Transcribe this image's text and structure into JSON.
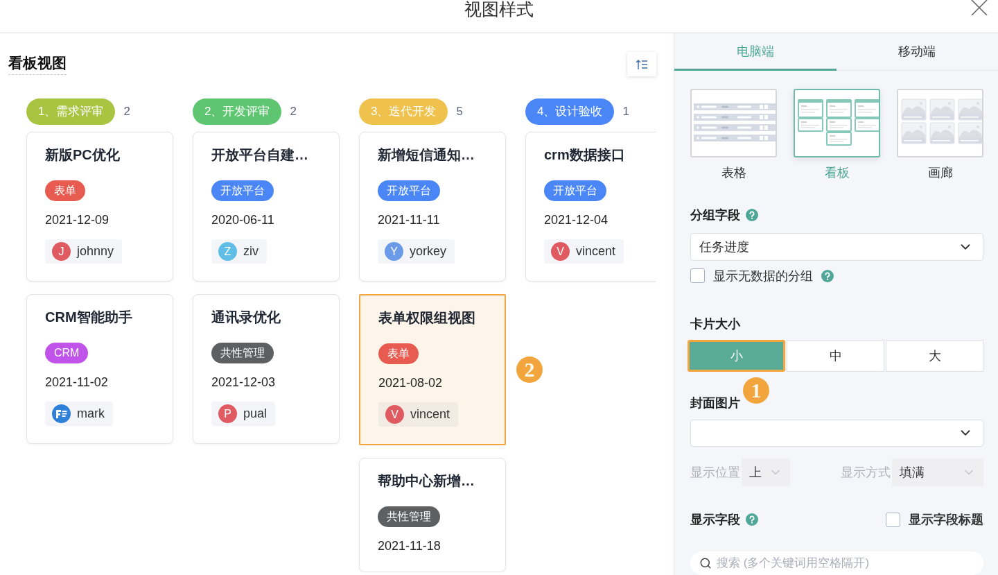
{
  "dialog": {
    "title": "视图样式"
  },
  "board": {
    "title": "看板视图",
    "columns": [
      {
        "label": "1、需求评审",
        "count": "2",
        "color": "#a9c440",
        "cards": [
          {
            "title": "新版PC优化",
            "tag": {
              "label": "表单",
              "color": "#e85b50"
            },
            "date": "2021-12-09",
            "assignee": {
              "kind": "letter",
              "initial": "J",
              "name": "johnny",
              "color": "#e05a62"
            },
            "highlighted": false
          },
          {
            "title": "CRM智能助手",
            "tag": {
              "label": "CRM",
              "color": "#c054ea"
            },
            "date": "2021-11-02",
            "assignee": {
              "kind": "logo",
              "name": "mark",
              "color": "#2f80d8"
            },
            "highlighted": false
          }
        ]
      },
      {
        "label": "2、开发评审",
        "count": "2",
        "color": "#5ec671",
        "cards": [
          {
            "title": "开放平台自建…",
            "tag": {
              "label": "开放平台",
              "color": "#4b86f6"
            },
            "date": "2020-06-11",
            "assignee": {
              "kind": "letter",
              "initial": "Z",
              "name": "ziv",
              "color": "#5fbde6"
            },
            "highlighted": false
          },
          {
            "title": "通讯录优化",
            "tag": {
              "label": "共性管理",
              "color": "#5e5f61"
            },
            "date": "2021-12-03",
            "assignee": {
              "kind": "letter",
              "initial": "P",
              "name": "pual",
              "color": "#e05a62"
            },
            "highlighted": false
          }
        ]
      },
      {
        "label": "3、迭代开发",
        "count": "5",
        "color": "#efc14d",
        "cards": [
          {
            "title": "新增短信通知…",
            "tag": {
              "label": "开放平台",
              "color": "#4b86f6"
            },
            "date": "2021-11-11",
            "assignee": {
              "kind": "letter",
              "initial": "Y",
              "name": "yorkey",
              "color": "#6b9ae8"
            },
            "highlighted": false
          },
          {
            "title": "表单权限组视图",
            "tag": {
              "label": "表单",
              "color": "#e85b50"
            },
            "date": "2021-08-02",
            "assignee": {
              "kind": "letter",
              "initial": "V",
              "name": "vincent",
              "color": "#e05a62"
            },
            "highlighted": true,
            "marker": "2"
          },
          {
            "title": "帮助中心新增…",
            "tag": {
              "label": "共性管理",
              "color": "#5e5f61"
            },
            "date": "2021-11-18",
            "highlighted": false
          }
        ]
      },
      {
        "label": "4、设计验收",
        "count": "1",
        "color": "#4b86f6",
        "cards": [
          {
            "title": "crm数据接口",
            "tag": {
              "label": "开放平台",
              "color": "#4b86f6"
            },
            "date": "2021-12-04",
            "assignee": {
              "kind": "letter",
              "initial": "V",
              "name": "vincent",
              "color": "#e05a62"
            },
            "highlighted": false
          }
        ]
      }
    ]
  },
  "settings": {
    "tabs": [
      {
        "label": "电脑端",
        "selected": true
      },
      {
        "label": "移动端",
        "selected": false
      }
    ],
    "style_options": [
      {
        "kind": "table",
        "label": "表格",
        "selected": false
      },
      {
        "kind": "kanban",
        "label": "看板",
        "selected": true
      },
      {
        "kind": "gallery",
        "label": "画廊",
        "selected": false
      }
    ],
    "group_field": {
      "label": "分组字段",
      "value": "任务进度",
      "empty_groups": {
        "label": "显示无数据的分组",
        "checked": false
      }
    },
    "card_size": {
      "label": "卡片大小",
      "marker": "1",
      "options": [
        {
          "label": "小",
          "selected": true,
          "highlighted": true
        },
        {
          "label": "中",
          "selected": false,
          "highlighted": false
        },
        {
          "label": "大",
          "selected": false,
          "highlighted": false
        }
      ]
    },
    "cover_image": {
      "label": "封面图片",
      "position": {
        "label": "显示位置",
        "value": "上",
        "disabled": true
      },
      "fit": {
        "label": "显示方式",
        "value": "填满",
        "disabled": true
      }
    },
    "display_fields": {
      "label": "显示字段",
      "show_titles": {
        "label": "显示字段标题",
        "checked": false
      },
      "search": {
        "placeholder": "搜索 (多个关键词用空格隔开)"
      }
    }
  }
}
